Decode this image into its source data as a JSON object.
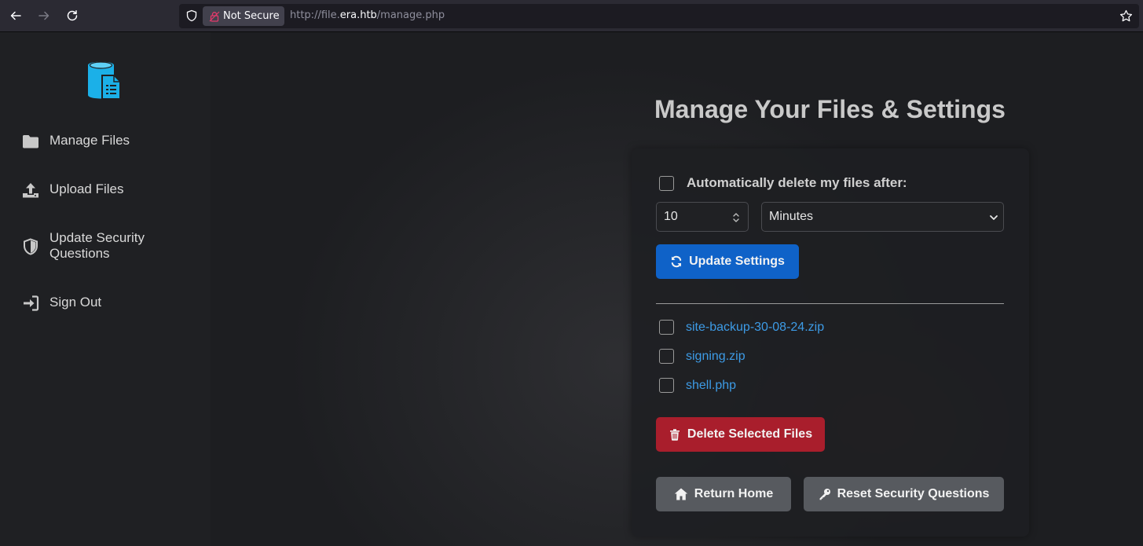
{
  "browser": {
    "security_label": "Not Secure",
    "url_prefix": "http://file.",
    "url_host": "era.htb",
    "url_path": "/manage.php",
    "icons": [
      "back-icon",
      "forward-icon",
      "reload-icon",
      "shield-icon",
      "lock-icon",
      "bookmark-star-icon"
    ]
  },
  "sidebar": {
    "logo_icon": "file-database-icon",
    "items": [
      {
        "label": "Manage Files",
        "icon": "folder-icon"
      },
      {
        "label": "Upload Files",
        "icon": "upload-icon"
      },
      {
        "label": "Update Security Questions",
        "icon": "shield-half-icon"
      },
      {
        "label": "Sign Out",
        "icon": "sign-in-icon"
      }
    ]
  },
  "main": {
    "title": "Manage Your Files & Settings",
    "auto_delete": {
      "label": "Automatically delete my files after:",
      "checked": false,
      "amount": "10",
      "unit": "Minutes"
    },
    "update_button": "Update Settings",
    "files": [
      {
        "name": "site-backup-30-08-24.zip",
        "checked": false
      },
      {
        "name": "signing.zip",
        "checked": false
      },
      {
        "name": "shell.php",
        "checked": false
      }
    ],
    "delete_button": "Delete Selected Files",
    "home_button": "Return Home",
    "reset_button": "Reset Security Questions"
  },
  "colors": {
    "primary": "#0f62c8",
    "danger": "#a91e2c",
    "secondary": "#575a5f",
    "link": "#3d9be6",
    "logo": "#1bb0e8"
  }
}
